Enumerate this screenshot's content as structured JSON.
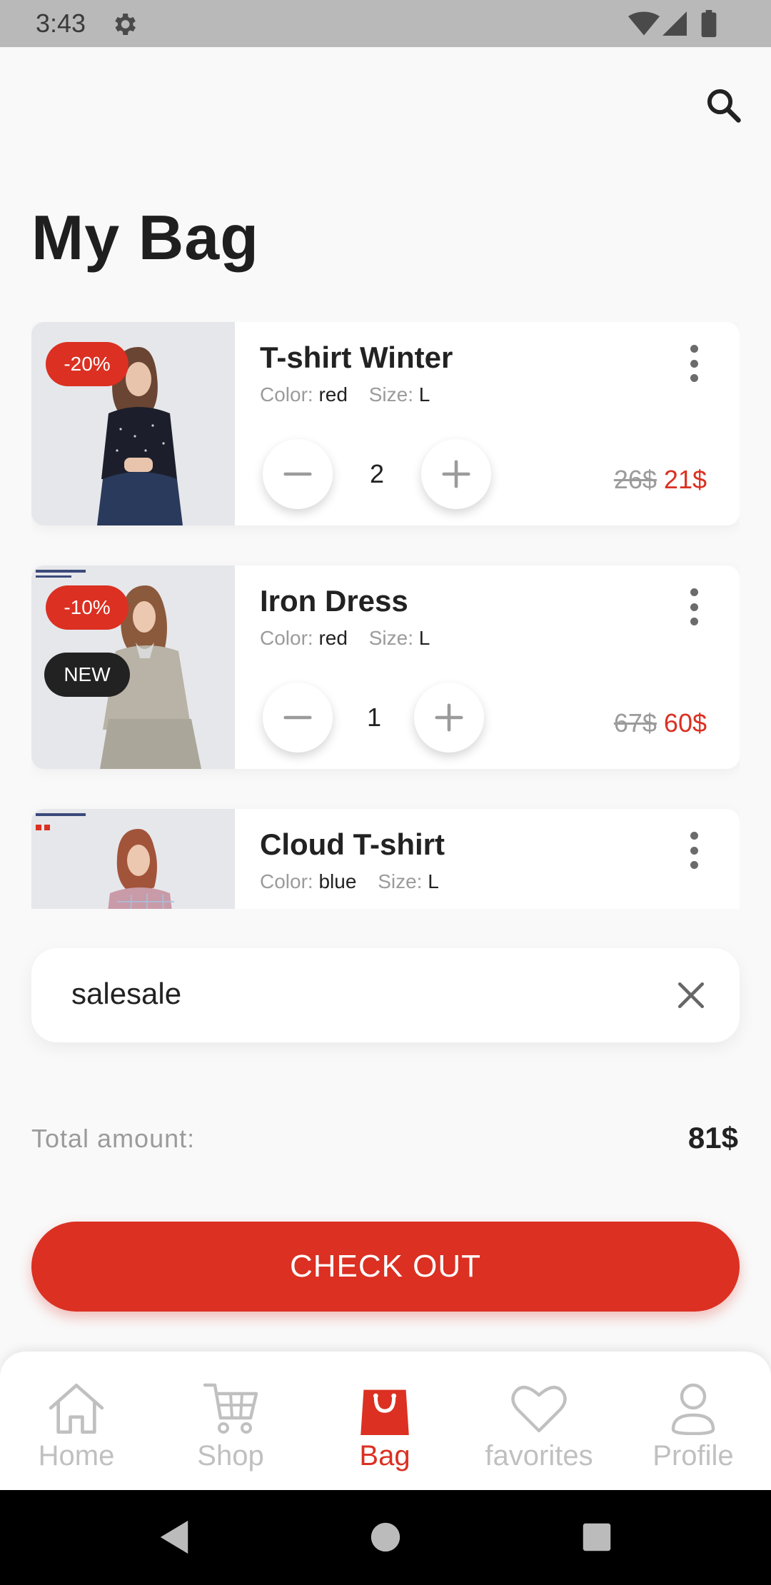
{
  "status_bar": {
    "time": "3:43"
  },
  "header": {
    "title": "My Bag",
    "search_icon": "search-icon"
  },
  "bag": {
    "items": [
      {
        "name": "T-shirt Winter",
        "color_label": "Color:",
        "color": "red",
        "size_label": "Size:",
        "size": "L",
        "quantity": "2",
        "old_price": "26$",
        "price": "21$",
        "discount": "-20%"
      },
      {
        "name": "Iron Dress",
        "color_label": "Color:",
        "color": "red",
        "size_label": "Size:",
        "size": "L",
        "quantity": "1",
        "old_price": "67$",
        "price": "60$",
        "discount": "-10%",
        "badge": "NEW"
      },
      {
        "name": "Cloud T-shirt",
        "color_label": "Color:",
        "color": "blue",
        "size_label": "Size:",
        "size": "L"
      }
    ]
  },
  "promo": {
    "code": "salesale",
    "clear_icon": "close-icon"
  },
  "total": {
    "label": "Total amount:",
    "value": "81$"
  },
  "checkout": {
    "label": "CHECK OUT"
  },
  "bottom_nav": {
    "items": [
      {
        "label": "Home",
        "icon": "home-icon",
        "active": false
      },
      {
        "label": "Shop",
        "icon": "cart-icon",
        "active": false
      },
      {
        "label": "Bag",
        "icon": "bag-icon",
        "active": true
      },
      {
        "label": "favorites",
        "icon": "heart-icon",
        "active": false
      },
      {
        "label": "Profile",
        "icon": "profile-icon",
        "active": false
      }
    ]
  },
  "colors": {
    "accent": "#DB3022",
    "text": "#222222",
    "muted": "#9B9B9B",
    "background": "#F9F9F9"
  }
}
